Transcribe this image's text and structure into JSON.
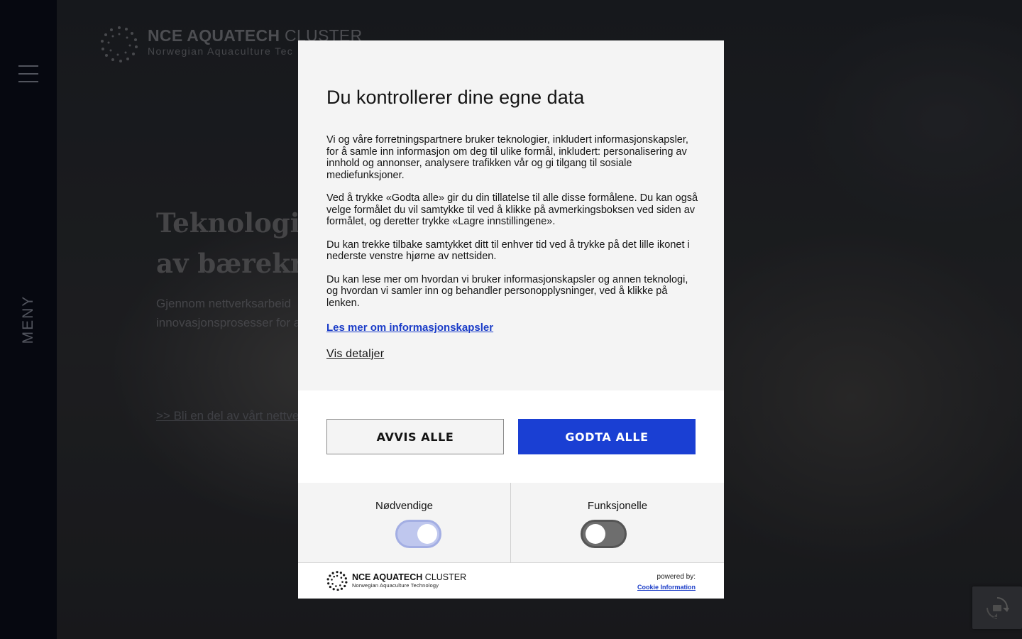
{
  "site": {
    "logo_title_bold": "NCE AQUATECH",
    "logo_title_light": "CLUSTER",
    "logo_subtitle": "Norwegian Aquaculture Tec",
    "menu_label": "MENY",
    "hero_title_line1": "Teknologi fo",
    "hero_title_line2": "av bærekraf",
    "hero_text_line1": "Gjennom nettverksarbeid",
    "hero_text_line2": "innovasjonsprosesser for a",
    "hero_link": ">> Bli en del av vårt nettve"
  },
  "consent": {
    "title": "Du kontrollerer dine egne data",
    "paragraphs": [
      "Vi og våre forretningspartnere bruker teknologier, inkludert informasjonskapsler, for å samle inn informasjon om deg til ulike formål, inkludert: personalisering av innhold og annonser, analysere trafikken vår og gi tilgang til sosiale mediefunksjoner.",
      "Ved å trykke «Godta alle» gir du din tillatelse til alle disse formålene. Du kan også velge formålet du vil samtykke til ved å klikke på avmerkingsboksen ved siden av formålet, og deretter trykke «Lagre innstillingene».",
      "Du kan trekke tilbake samtykket ditt til enhver tid ved å trykke på det lille ikonet i nederste venstre hjørne av nettsiden.",
      "Du kan lese mer om hvordan vi bruker informasjonskapsler og annen teknologi, og hvordan vi samler inn og behandler personopplysninger, ved å klikke på lenken."
    ],
    "learn_more_link": "Les mer om informasjonskapsler",
    "show_details": "Vis detaljer",
    "reject_all": "AVVIS ALLE",
    "accept_all": "GODTA ALLE",
    "toggles": [
      {
        "label": "Nødvendige",
        "state": "on-disabled"
      },
      {
        "label": "Funksjonelle",
        "state": "off"
      }
    ],
    "footer_logo_bold": "NCE AQUATECH",
    "footer_logo_light": "CLUSTER",
    "footer_logo_subtitle": "Norwegian Aquaculture Technology",
    "powered_by": "powered by:",
    "powered_link": "Cookie Information"
  },
  "colors": {
    "accent": "#1a3fd3",
    "link": "#1a3cc8",
    "sidebar": "#0a0d1a",
    "dialog_bg": "#f4f4f4"
  }
}
